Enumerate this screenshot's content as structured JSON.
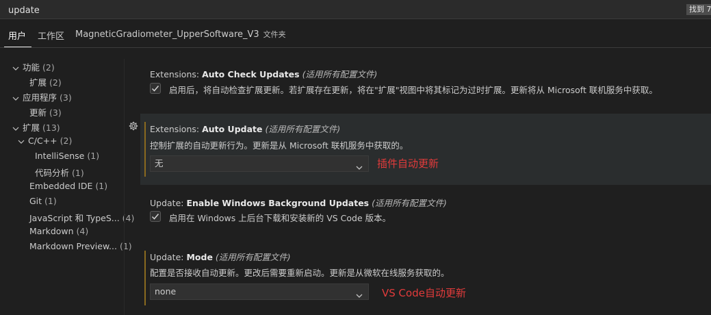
{
  "search": {
    "value": "update",
    "found_label": "找到 7"
  },
  "tabs": [
    {
      "label": "用户"
    },
    {
      "label": "工作区"
    },
    {
      "label": "MagneticGradiometer_UpperSoftware_V3",
      "suffix": "文件夹"
    }
  ],
  "toc": [
    {
      "label": "功能",
      "count": "(2)"
    },
    {
      "label": "扩展",
      "count": "(2)"
    },
    {
      "label": "应用程序",
      "count": "(3)"
    },
    {
      "label": "更新",
      "count": "(3)"
    },
    {
      "label": "扩展",
      "count": "(13)"
    },
    {
      "label": "C/C++",
      "count": "(2)"
    },
    {
      "label": "IntelliSense",
      "count": "(1)"
    },
    {
      "label": "代码分析",
      "count": "(1)"
    },
    {
      "label": "Embedded IDE",
      "count": "(1)"
    },
    {
      "label": "Git",
      "count": "(1)"
    },
    {
      "label": "JavaScript 和 TypeS...",
      "count": "(4)"
    },
    {
      "label": "Markdown",
      "count": "(4)"
    },
    {
      "label": "Markdown Preview...",
      "count": "(1)"
    }
  ],
  "settings": [
    {
      "category": "Extensions: ",
      "name": "Auto Check Updates",
      "scope": "(适用所有配置文件)",
      "description": "启用后，将自动检查扩展更新。若扩展存在更新，将在\"扩展\"视图中将其标记为过时扩展。更新将从 Microsoft 联机服务中获取。",
      "checked": true
    },
    {
      "category": "Extensions: ",
      "name": "Auto Update",
      "scope": "(适用所有配置文件)",
      "description": "控制扩展的自动更新行为。更新是从 Microsoft 联机服务中获取的。",
      "value": "无",
      "annotation": "插件自动更新"
    },
    {
      "category": "Update: ",
      "name": "Enable Windows Background Updates",
      "scope": "(适用所有配置文件)",
      "description": "启用在 Windows 上后台下载和安装新的 VS Code 版本。",
      "checked": true
    },
    {
      "category": "Update: ",
      "name": "Mode",
      "scope": "(适用所有配置文件)",
      "description": "配置是否接收自动更新。更改后需要重新启动。更新是从微软在线服务获取的。",
      "value": "none",
      "annotation": "VS Code自动更新"
    }
  ],
  "colors": {
    "background": "#1f1f1f",
    "annotation": "#e23b3b",
    "modified": "#8a6a1f"
  }
}
